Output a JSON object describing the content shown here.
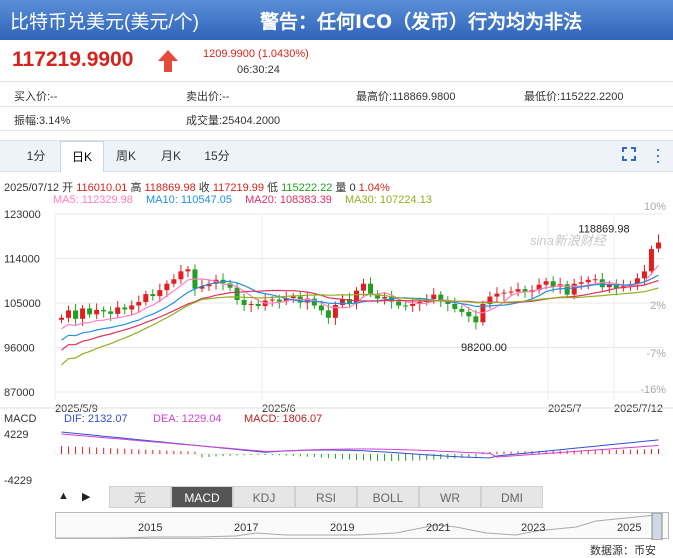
{
  "header": {
    "title": "比特币兑美元(美元/个)",
    "warning": "警告：任何ICO（发币）行为均为非法"
  },
  "quote": {
    "price": "117219.9900",
    "change": "1209.9900 (1.0430%)",
    "time": "06:30:24"
  },
  "info": {
    "bid": "买入价:--",
    "ask": "卖出价:--",
    "high": "最高价:118869.9800",
    "low": "最低价:115222.2200",
    "amplitude": "振幅:3.14%",
    "volume": "成交量:25404.2000"
  },
  "tabs": [
    "1分",
    "日K",
    "周K",
    "月K",
    "15分"
  ],
  "active_tab": "日K",
  "ohlc": {
    "date": "2025/07/12",
    "open_label": "开",
    "open": "116010.01",
    "high_label": "高",
    "high": "118869.98",
    "close_label": "收",
    "close": "117219.99",
    "low_label": "低",
    "low": "115222.22",
    "vol_label": "量",
    "vol": "0",
    "pct": "1.04%"
  },
  "ma": {
    "ma5": "MA5: 112329.98",
    "ma10": "MA10: 110547.05",
    "ma20": "MA20: 108383.39",
    "ma30": "MA30: 107224.13"
  },
  "colors": {
    "up": "#e02020",
    "down": "#20a020",
    "ma5": "#ff80c0",
    "ma10": "#2090e0",
    "ma20": "#e03060",
    "ma30": "#90b020",
    "accent": "#2f6cc1"
  },
  "watermark": "sina新浪财经",
  "chart_data": {
    "type": "candlestick",
    "y_ticks": [
      "123000",
      "114000",
      "105000",
      "96000",
      "87000"
    ],
    "pct_ticks": [
      "10%",
      "2%",
      "-7%",
      "-16%"
    ],
    "x_ticks": [
      "2025/5/9",
      "2025/6",
      "2025/7",
      "2025/7/12"
    ],
    "max_label": "118869.98",
    "min_label": "98200.00",
    "ylim": [
      87000,
      123000
    ],
    "closes": [
      102000,
      103500,
      101800,
      103900,
      102700,
      103600,
      103300,
      102800,
      104100,
      103700,
      104500,
      105200,
      106800,
      106400,
      107600,
      108900,
      109800,
      111400,
      111800,
      107900,
      108400,
      108900,
      109700,
      109000,
      108100,
      105600,
      104600,
      104800,
      104400,
      105500,
      105700,
      105300,
      106000,
      106300,
      105100,
      105900,
      104500,
      103500,
      102000,
      104600,
      105800,
      104900,
      107500,
      108900,
      106900,
      105900,
      106200,
      105300,
      104500,
      104400,
      104800,
      105200,
      105800,
      106700,
      105400,
      104800,
      103800,
      103200,
      102300,
      101100,
      104800,
      106300,
      106900,
      107100,
      107300,
      107800,
      107200,
      107600,
      108700,
      109400,
      108300,
      108800,
      106700,
      108900,
      109200,
      109700,
      109800,
      108200,
      108800,
      108000,
      108400,
      108800,
      110000,
      111400,
      115900,
      117220
    ]
  },
  "macd": {
    "label": "MACD",
    "dif": "DIF: 2132.07",
    "dea": "DEA: 1229.04",
    "macd": "MACD: 1806.07",
    "top": "4229",
    "bottom": "-4229"
  },
  "indicators": [
    "无",
    "MACD",
    "KDJ",
    "RSI",
    "BOLL",
    "WR",
    "DMI"
  ],
  "active_indicator": "MACD",
  "nav_buttons": [
    "▲",
    "▶"
  ],
  "navigator_years": [
    "2015",
    "2017",
    "2019",
    "2021",
    "2023",
    "2025"
  ],
  "source": "数据源：币安"
}
